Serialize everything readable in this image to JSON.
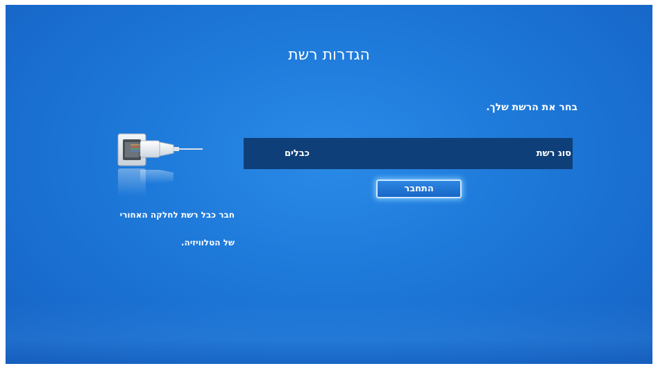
{
  "header": {
    "title": "הגדרות רשת"
  },
  "main": {
    "prompt": "בחר את הרשת שלך.",
    "network_type": {
      "label": "סוג רשת",
      "value": "כבלים"
    },
    "connect_button": "התחבר"
  },
  "side_panel": {
    "instruction_line1": "חבר כבל רשת לחלקה האחורי",
    "instruction_line2": "של הטלוויזיה.",
    "illustration_icon": "ethernet-cable-port-icon"
  },
  "colors": {
    "background": "#1d78d8",
    "row_background": "#0f3f78",
    "focus_glow": "#8cd2ff",
    "text": "#ffffff"
  }
}
